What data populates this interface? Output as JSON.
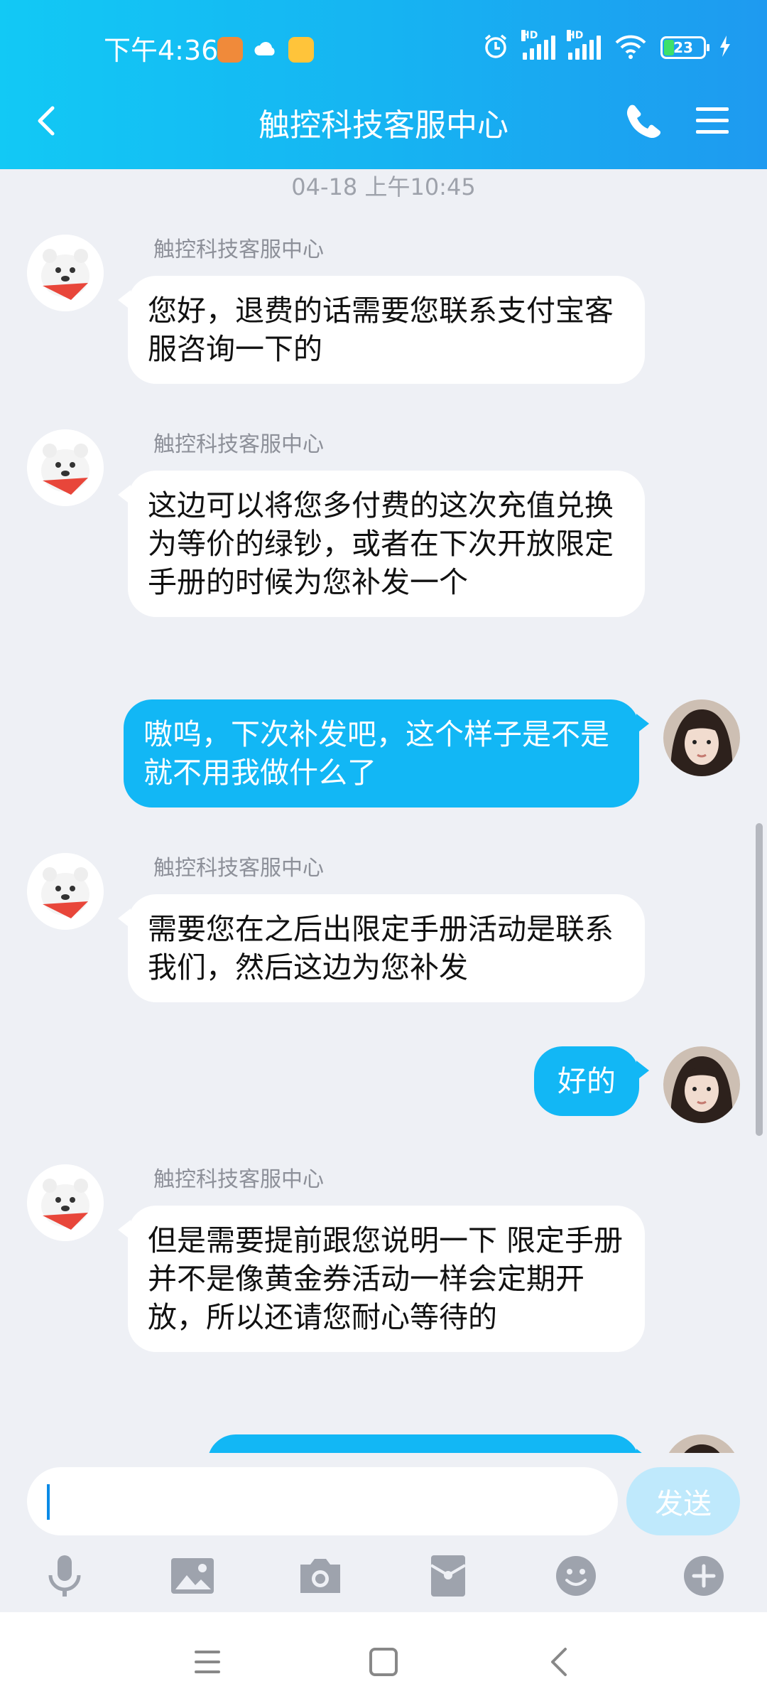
{
  "status": {
    "time": "下午4:36",
    "battery": "23"
  },
  "nav": {
    "title": "触控科技客服中心"
  },
  "chat": {
    "timestamp": "04-18 上午10:45",
    "messages": [
      {
        "sender": "触控科技客服中心",
        "text": "您好，退费的话需要您联系支付宝客服咨询一下的"
      },
      {
        "sender": "触控科技客服中心",
        "text": "这边可以将您多付费的这次充值兑换为等价的绿钞，或者在下次开放限定手册的时候为您补发一个"
      },
      {
        "text": "嗷呜，下次补发吧，这个样子是不是就不用我做什么了"
      },
      {
        "sender": "触控科技客服中心",
        "text": "需要您在之后出限定手册活动是联系我们，然后这边为您补发"
      },
      {
        "text": "好的"
      },
      {
        "sender": "触控科技客服中心",
        "text": "但是需要提前跟您说明一下 限定手册并不是像黄金券活动一样会定期开放，所以还请您耐心等待的"
      }
    ]
  },
  "composer": {
    "send_label": "发送",
    "value": ""
  },
  "colors": {
    "accent": "#12b7f5",
    "background": "#eef0f5",
    "send_disabled": "#bfe9fc"
  },
  "icons": [
    "back-arrow-icon",
    "phone-icon",
    "menu-icon",
    "microphone-icon",
    "image-icon",
    "camera-icon",
    "red-packet-icon",
    "emoji-icon",
    "plus-icon"
  ]
}
